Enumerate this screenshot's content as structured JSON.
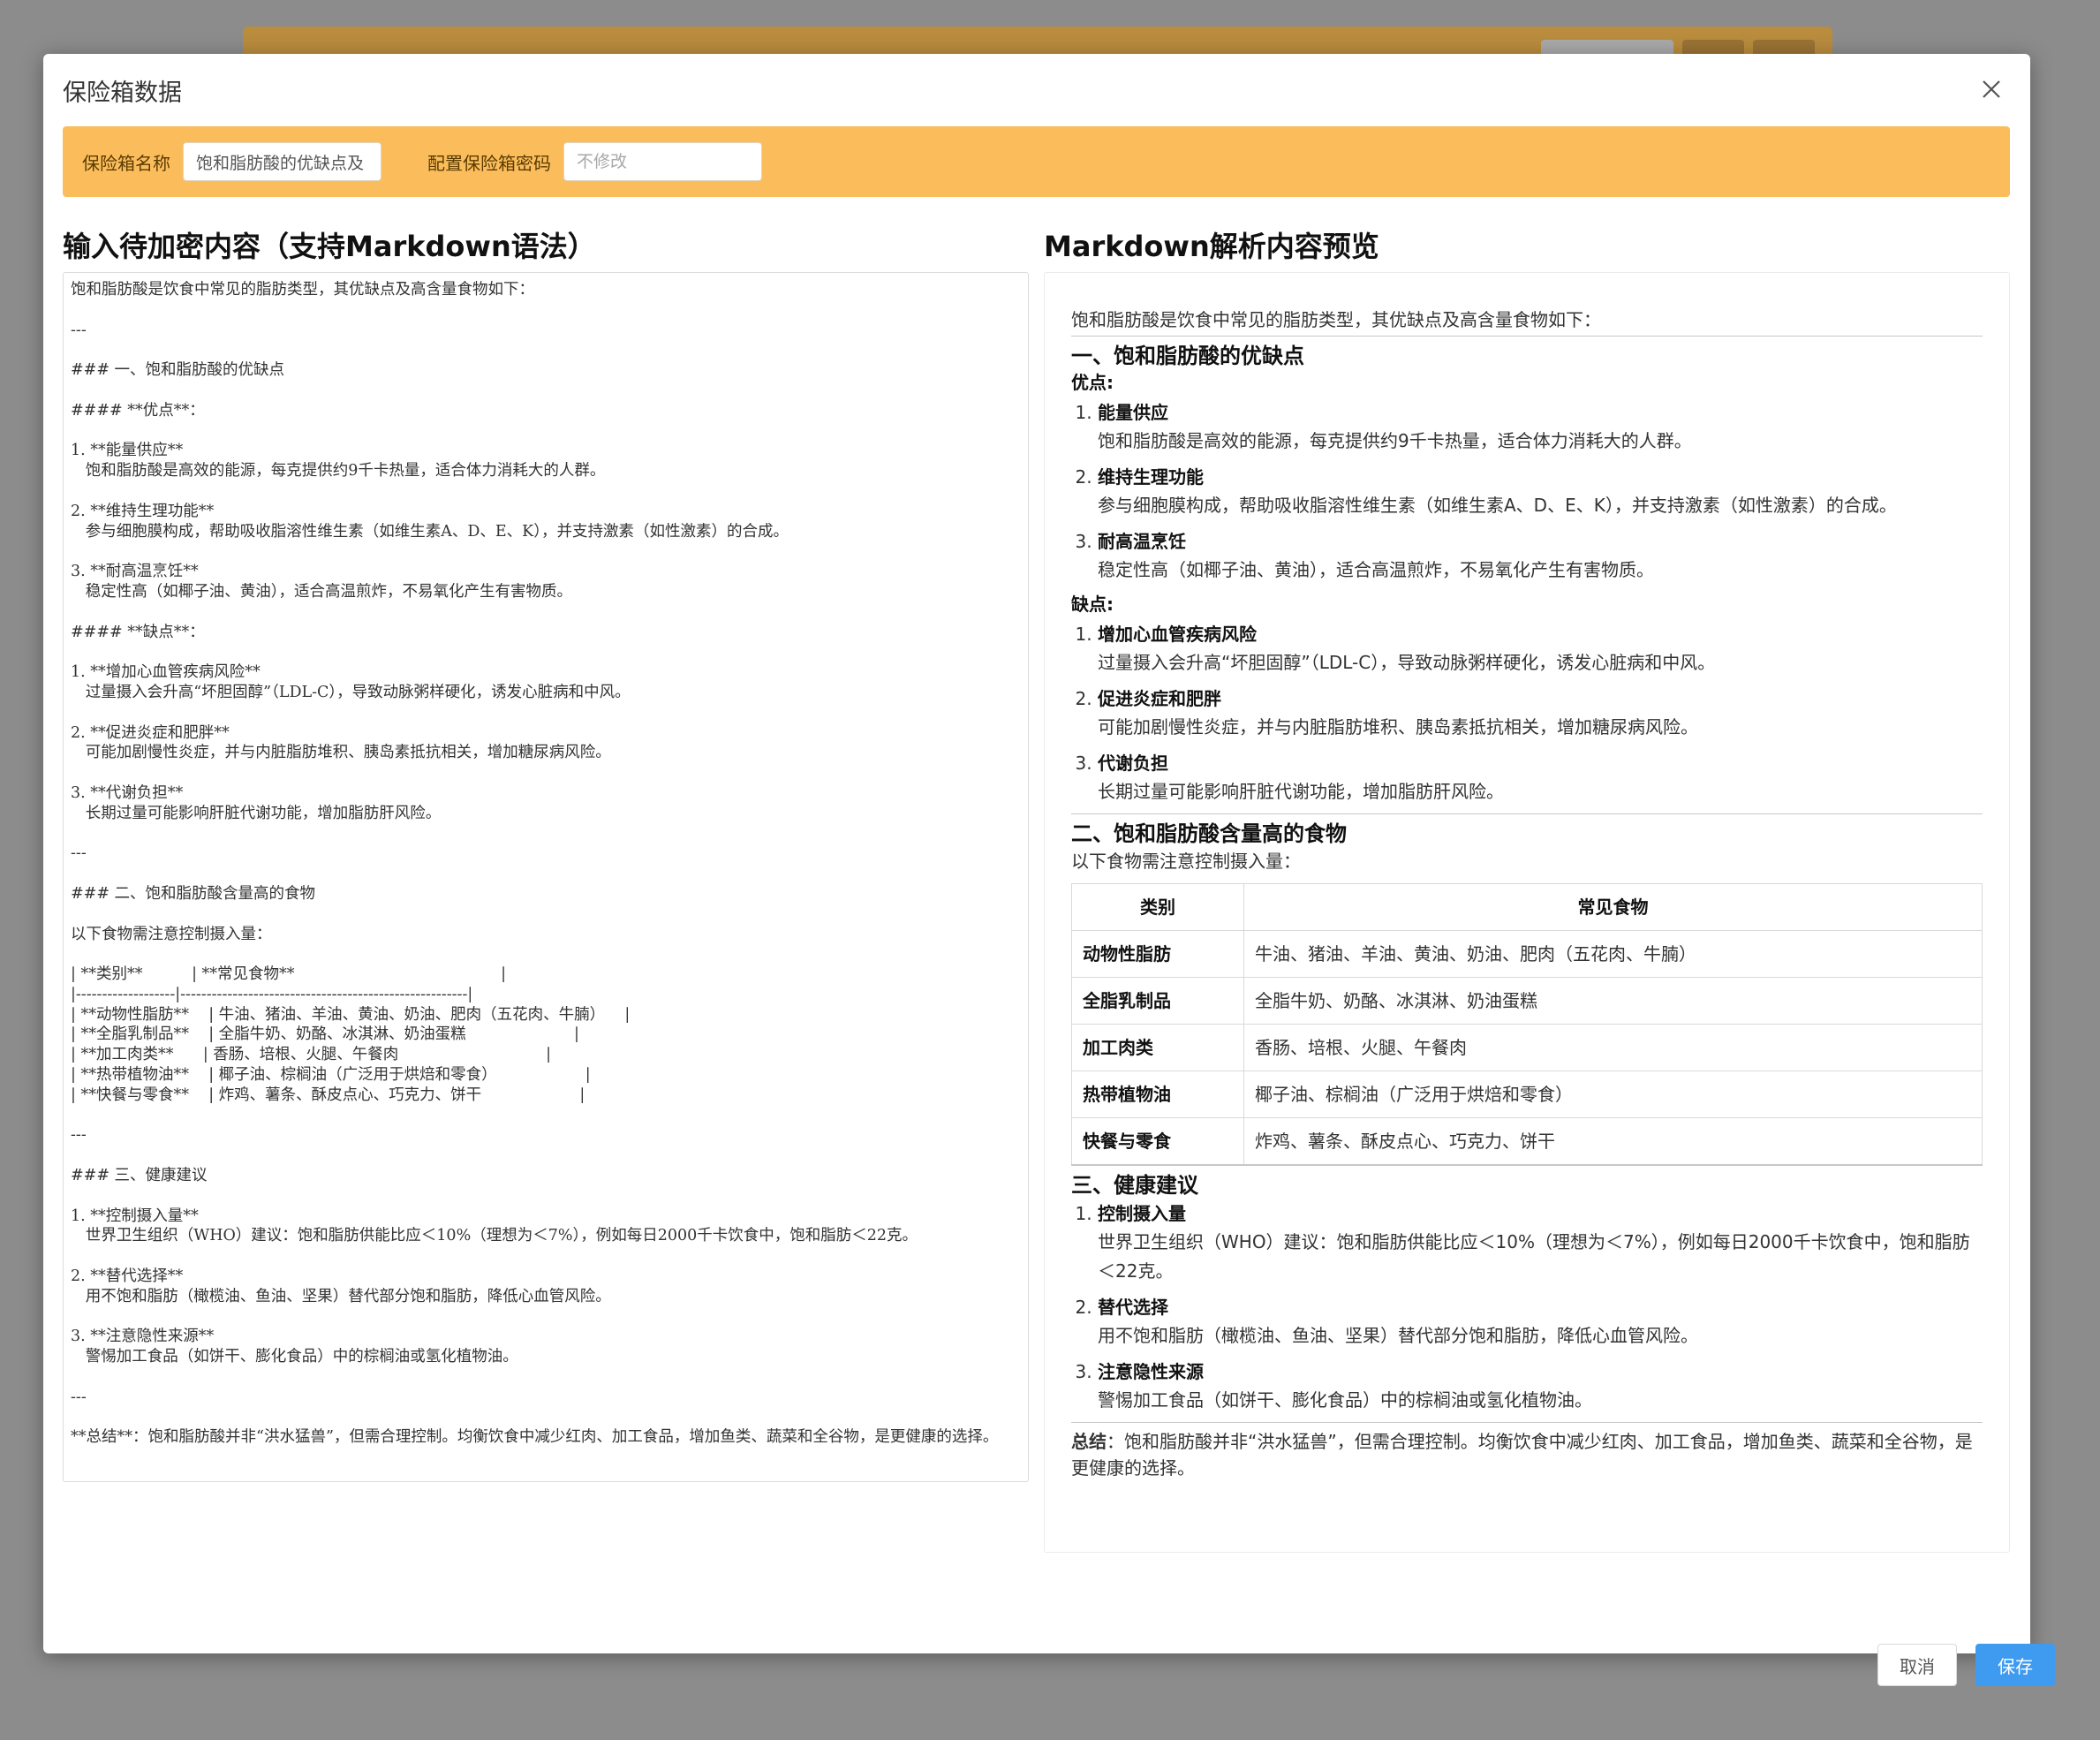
{
  "modal": {
    "title": "保险箱数据",
    "close_icon": "close-icon"
  },
  "config": {
    "name_label": "保险箱名称",
    "name_value": "饱和脂肪酸的优缺点及",
    "password_label": "配置保险箱密码",
    "password_placeholder": "不修改"
  },
  "editor": {
    "title": "输入待加密内容（支持Markdown语法）",
    "content": "饱和脂肪酸是饮食中常见的脂肪类型，其优缺点及高含量食物如下：\n\n---\n\n### 一、饱和脂肪酸的优缺点\n\n#### **优点**：\n\n1. **能量供应**\n   饱和脂肪酸是高效的能源，每克提供约9千卡热量，适合体力消耗大的人群。\n\n2. **维持生理功能**\n   参与细胞膜构成，帮助吸收脂溶性维生素（如维生素A、D、E、K），并支持激素（如性激素）的合成。\n\n3. **耐高温烹饪**\n   稳定性高（如椰子油、黄油），适合高温煎炸，不易氧化产生有害物质。\n\n#### **缺点**：\n\n1. **增加心血管疾病风险**\n   过量摄入会升高“坏胆固醇”（LDL-C），导致动脉粥样硬化，诱发心脏病和中风。\n\n2. **促进炎症和肥胖**\n   可能加剧慢性炎症，并与内脏脂肪堆积、胰岛素抵抗相关，增加糖尿病风险。\n\n3. **代谢负担**\n   长期过量可能影响肝脏代谢功能，增加脂肪肝风险。\n\n---\n\n### 二、饱和脂肪酸含量高的食物\n\n以下食物需注意控制摄入量：\n\n| **类别**          | **常见食物**                                          |\n|-------------------|-------------------------------------------------------|\n| **动物性脂肪**    | 牛油、猪油、羊油、黄油、奶油、肥肉（五花肉、牛腩）    |\n| **全脂乳制品**    | 全脂牛奶、奶酪、冰淇淋、奶油蛋糕                      |\n| **加工肉类**      | 香肠、培根、火腿、午餐肉                              |\n| **热带植物油**    | 椰子油、棕榈油（广泛用于烘焙和零食）                  |\n| **快餐与零食**    | 炸鸡、薯条、酥皮点心、巧克力、饼干                    |\n\n---\n\n### 三、健康建议\n\n1. **控制摄入量**\n   世界卫生组织（WHO）建议：饱和脂肪供能比应＜10%（理想为＜7%），例如每日2000千卡饮食中，饱和脂肪＜22克。\n\n2. **替代选择**\n   用不饱和脂肪（橄榄油、鱼油、坚果）替代部分饱和脂肪，降低心血管风险。\n\n3. **注意隐性来源**\n   警惕加工食品（如饼干、膨化食品）中的棕榈油或氢化植物油。\n\n---\n\n**总结**：饱和脂肪酸并非“洪水猛兽”，但需合理控制。均衡饮食中减少红肉、加工食品，增加鱼类、蔬菜和全谷物，是更健康的选择。"
  },
  "preview": {
    "title": "Markdown解析内容预览",
    "intro": "饱和脂肪酸是饮食中常见的脂肪类型，其优缺点及高含量食物如下：",
    "section1_title": "一、饱和脂肪酸的优缺点",
    "pros_label": "优点:",
    "pros": [
      {
        "title": "能量供应",
        "desc": "饱和脂肪酸是高效的能源，每克提供约9千卡热量，适合体力消耗大的人群。"
      },
      {
        "title": "维持生理功能",
        "desc": "参与细胞膜构成，帮助吸收脂溶性维生素（如维生素A、D、E、K），并支持激素（如性激素）的合成。"
      },
      {
        "title": "耐高温烹饪",
        "desc": "稳定性高（如椰子油、黄油），适合高温煎炸，不易氧化产生有害物质。"
      }
    ],
    "cons_label": "缺点:",
    "cons": [
      {
        "title": "增加心血管疾病风险",
        "desc": "过量摄入会升高“坏胆固醇”（LDL-C），导致动脉粥样硬化，诱发心脏病和中风。"
      },
      {
        "title": "促进炎症和肥胖",
        "desc": "可能加剧慢性炎症，并与内脏脂肪堆积、胰岛素抵抗相关，增加糖尿病风险。"
      },
      {
        "title": "代谢负担",
        "desc": "长期过量可能影响肝脏代谢功能，增加脂肪肝风险。"
      }
    ],
    "section2_title": "二、饱和脂肪酸含量高的食物",
    "section2_intro": "以下食物需注意控制摄入量：",
    "table": {
      "headers": [
        "类别",
        "常见食物"
      ],
      "rows": [
        [
          "动物性脂肪",
          "牛油、猪油、羊油、黄油、奶油、肥肉（五花肉、牛腩）"
        ],
        [
          "全脂乳制品",
          "全脂牛奶、奶酪、冰淇淋、奶油蛋糕"
        ],
        [
          "加工肉类",
          "香肠、培根、火腿、午餐肉"
        ],
        [
          "热带植物油",
          "椰子油、棕榈油（广泛用于烘焙和零食）"
        ],
        [
          "快餐与零食",
          "炸鸡、薯条、酥皮点心、巧克力、饼干"
        ]
      ]
    },
    "section3_title": "三、健康建议",
    "advice": [
      {
        "title": "控制摄入量",
        "desc": "世界卫生组织（WHO）建议：饱和脂肪供能比应＜10%（理想为＜7%），例如每日2000千卡饮食中，饱和脂肪＜22克。"
      },
      {
        "title": "替代选择",
        "desc": "用不饱和脂肪（橄榄油、鱼油、坚果）替代部分饱和脂肪，降低心血管风险。"
      },
      {
        "title": "注意隐性来源",
        "desc": "警惕加工食品（如饼干、膨化食品）中的棕榈油或氢化植物油。"
      }
    ],
    "summary_label": "总结",
    "summary_text": "：饱和脂肪酸并非“洪水猛兽”，但需合理控制。均衡饮食中减少红肉、加工食品，增加鱼类、蔬菜和全谷物，是更健康的选择。"
  },
  "footer": {
    "cancel_label": "取消",
    "save_label": "保存"
  },
  "colors": {
    "config_bar": "#fbbd5c",
    "save_button": "#3e9bf0",
    "overlay": "#8c8c8c"
  }
}
